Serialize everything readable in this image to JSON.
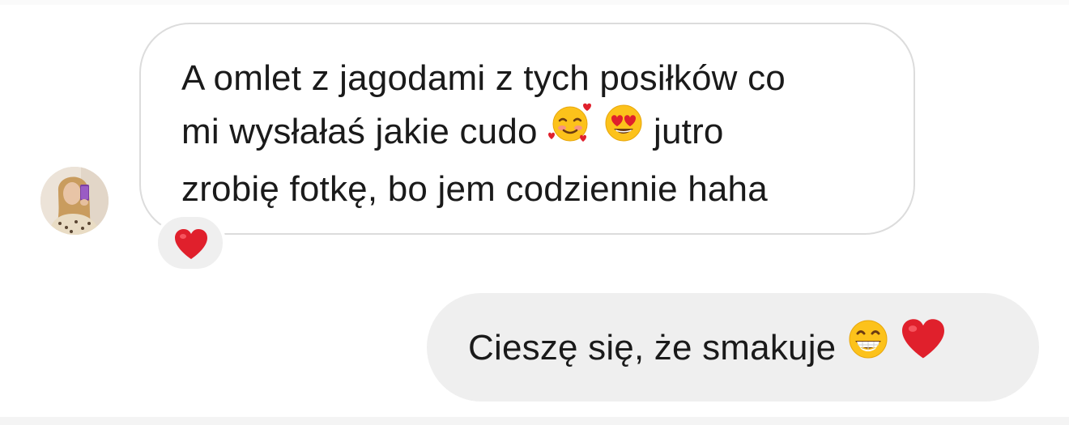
{
  "messages": [
    {
      "direction": "incoming",
      "line1": "A omlet z jagodami z tych posiłków co",
      "line2_before": "mi wysłałaś jakie cudo",
      "line2_after": "jutro",
      "line3": "zrobię fotkę, bo jem codziennie haha",
      "emojis": [
        "smiling-face-with-hearts-emoji",
        "heart-eyes-emoji"
      ],
      "reaction": "red-heart-emoji"
    },
    {
      "direction": "outgoing",
      "text": "Cieszę się, że smakuje",
      "emojis": [
        "grinning-face-emoji",
        "red-heart-emoji"
      ]
    }
  ],
  "colors": {
    "incoming_border": "#dcdcdc",
    "outgoing_bg": "#efefef",
    "reaction_bg": "#efefef",
    "heart": "#e0202c"
  }
}
